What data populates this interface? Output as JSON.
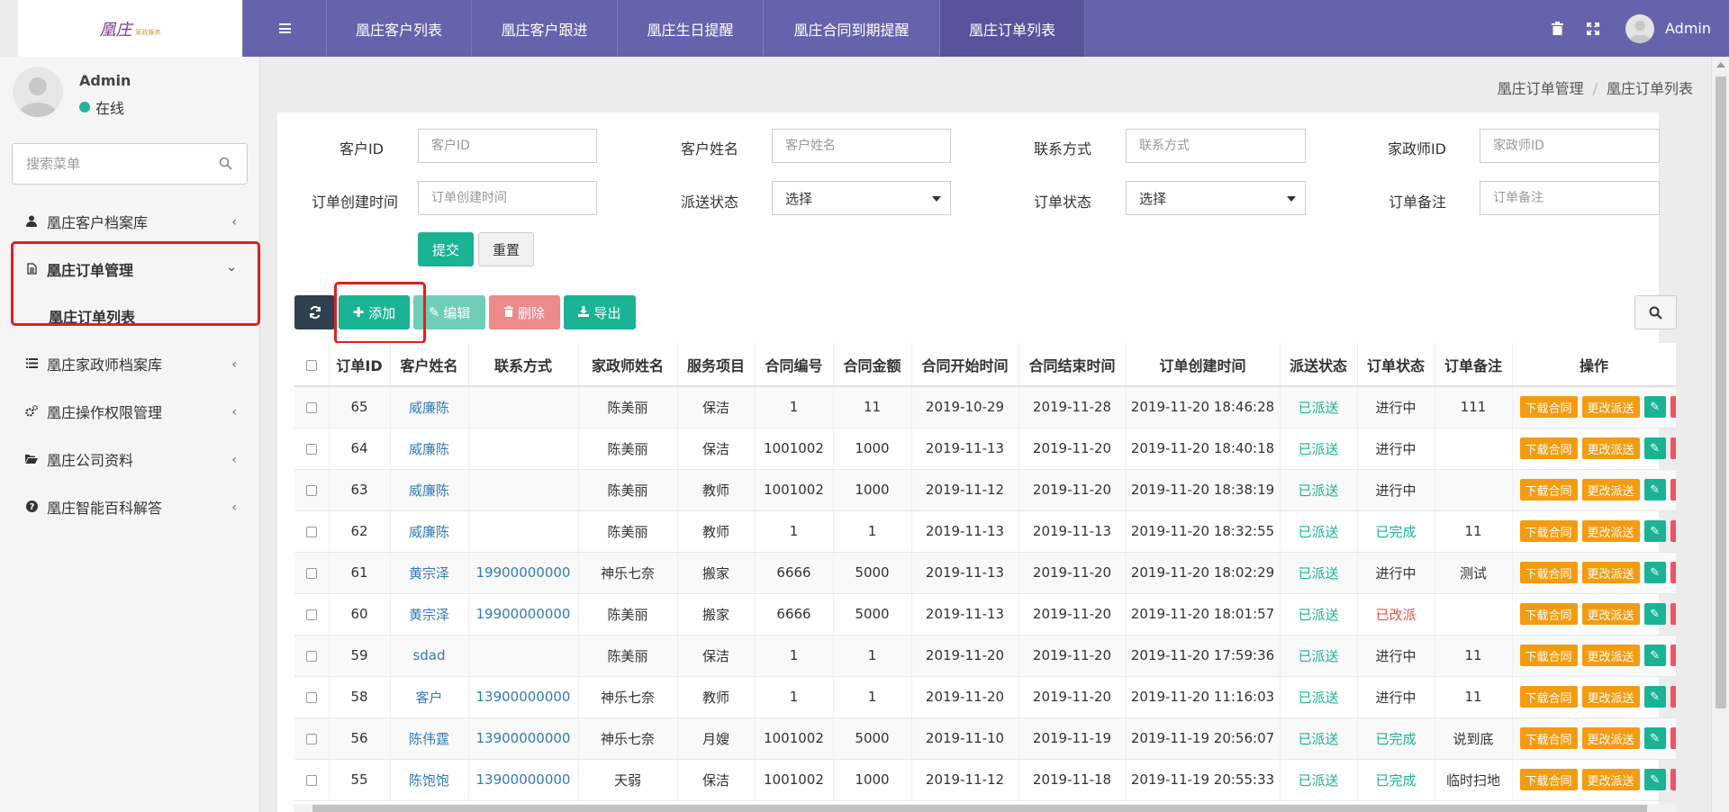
{
  "logo": {
    "text": "凰庄",
    "sub": "家政服务"
  },
  "topbar": {
    "tabs": [
      "凰庄客户列表",
      "凰庄客户跟进",
      "凰庄生日提醒",
      "凰庄合同到期提醒",
      "凰庄订单列表"
    ],
    "active_tab": "凰庄订单列表",
    "user": "Admin"
  },
  "sidebar": {
    "user_name": "Admin",
    "status": "在线",
    "search_placeholder": "搜索菜单",
    "items": [
      {
        "label": "凰庄客户档案库",
        "icon": "user-icon"
      },
      {
        "label": "凰庄订单管理",
        "icon": "file-icon"
      },
      {
        "label": "凰庄订单列表"
      },
      {
        "label": "凰庄家政师档案库",
        "icon": "list-icon"
      },
      {
        "label": "凰庄操作权限管理",
        "icon": "gears-icon"
      },
      {
        "label": "凰庄公司资料",
        "icon": "folder-open-icon"
      },
      {
        "label": "凰庄智能百科解答",
        "icon": "question-circle-icon"
      }
    ]
  },
  "breadcrumb": {
    "parent": "凰庄订单管理",
    "current": "凰庄订单列表"
  },
  "filters": {
    "customer_id": {
      "label": "客户ID",
      "placeholder": "客户ID"
    },
    "customer_name": {
      "label": "客户姓名",
      "placeholder": "客户姓名"
    },
    "contact": {
      "label": "联系方式",
      "placeholder": "联系方式"
    },
    "housekeeper_id": {
      "label": "家政师ID",
      "placeholder": "家政师ID"
    },
    "created_time": {
      "label": "订单创建时间",
      "placeholder": "订单创建时间"
    },
    "dispatch_status": {
      "label": "派送状态",
      "value": "选择"
    },
    "order_status": {
      "label": "订单状态",
      "value": "选择"
    },
    "order_note": {
      "label": "订单备注",
      "placeholder": "订单备注"
    },
    "submit": "提交",
    "reset": "重置"
  },
  "toolbar": {
    "add": "添加",
    "edit": "编辑",
    "delete": "删除",
    "export": "导出"
  },
  "table": {
    "headers": [
      "订单ID",
      "客户姓名",
      "联系方式",
      "家政师姓名",
      "服务项目",
      "合同编号",
      "合同金额",
      "合同开始时间",
      "合同结束时间",
      "订单创建时间",
      "派送状态",
      "订单状态",
      "订单备注",
      "操作"
    ],
    "rows": [
      [
        "65",
        "威廉陈",
        "",
        "陈美丽",
        "保洁",
        "1",
        "11",
        "2019-10-29",
        "2019-11-28",
        "2019-11-20 18:46:28",
        "已派送",
        "进行中",
        "111"
      ],
      [
        "64",
        "威廉陈",
        "",
        "陈美丽",
        "保洁",
        "1001002",
        "1000",
        "2019-11-13",
        "2019-11-20",
        "2019-11-20 18:40:18",
        "已派送",
        "进行中",
        ""
      ],
      [
        "63",
        "威廉陈",
        "",
        "陈美丽",
        "教师",
        "1001002",
        "1000",
        "2019-11-12",
        "2019-11-20",
        "2019-11-20 18:38:19",
        "已派送",
        "进行中",
        ""
      ],
      [
        "62",
        "威廉陈",
        "",
        "陈美丽",
        "教师",
        "1",
        "1",
        "2019-11-13",
        "2019-11-13",
        "2019-11-20 18:32:55",
        "已派送",
        "已完成",
        "11"
      ],
      [
        "61",
        "黄宗泽",
        "19900000000",
        "神乐七奈",
        "搬家",
        "6666",
        "5000",
        "2019-11-13",
        "2019-11-20",
        "2019-11-20 18:02:29",
        "已派送",
        "进行中",
        "测试"
      ],
      [
        "60",
        "黄宗泽",
        "19900000000",
        "陈美丽",
        "搬家",
        "6666",
        "5000",
        "2019-11-13",
        "2019-11-20",
        "2019-11-20 18:01:57",
        "已派送",
        "已改派",
        ""
      ],
      [
        "59",
        "sdad",
        "",
        "陈美丽",
        "保洁",
        "1",
        "1",
        "2019-11-20",
        "2019-11-20",
        "2019-11-20 17:59:36",
        "已派送",
        "进行中",
        "11"
      ],
      [
        "58",
        "客户",
        "13900000000",
        "神乐七奈",
        "教师",
        "1",
        "1",
        "2019-11-20",
        "2019-11-20",
        "2019-11-20 11:16:03",
        "已派送",
        "进行中",
        "11"
      ],
      [
        "56",
        "陈伟霆",
        "13900000000",
        "神乐七奈",
        "月嫂",
        "1001002",
        "5000",
        "2019-11-10",
        "2019-11-19",
        "2019-11-19 20:56:07",
        "已派送",
        "已完成",
        "说到底"
      ],
      [
        "55",
        "陈饱饱",
        "13900000000",
        "天弱",
        "保洁",
        "1001002",
        "1000",
        "2019-11-12",
        "2019-11-18",
        "2019-11-19 20:55:33",
        "已派送",
        "已完成",
        "临时扫地"
      ]
    ],
    "op_download": "下载合同",
    "op_change": "更改派送"
  },
  "colors": {
    "topbar": "#6663ad",
    "primary": "#1ab394",
    "warning": "#f39c12",
    "danger": "#e5534b",
    "link": "#337ab7"
  }
}
